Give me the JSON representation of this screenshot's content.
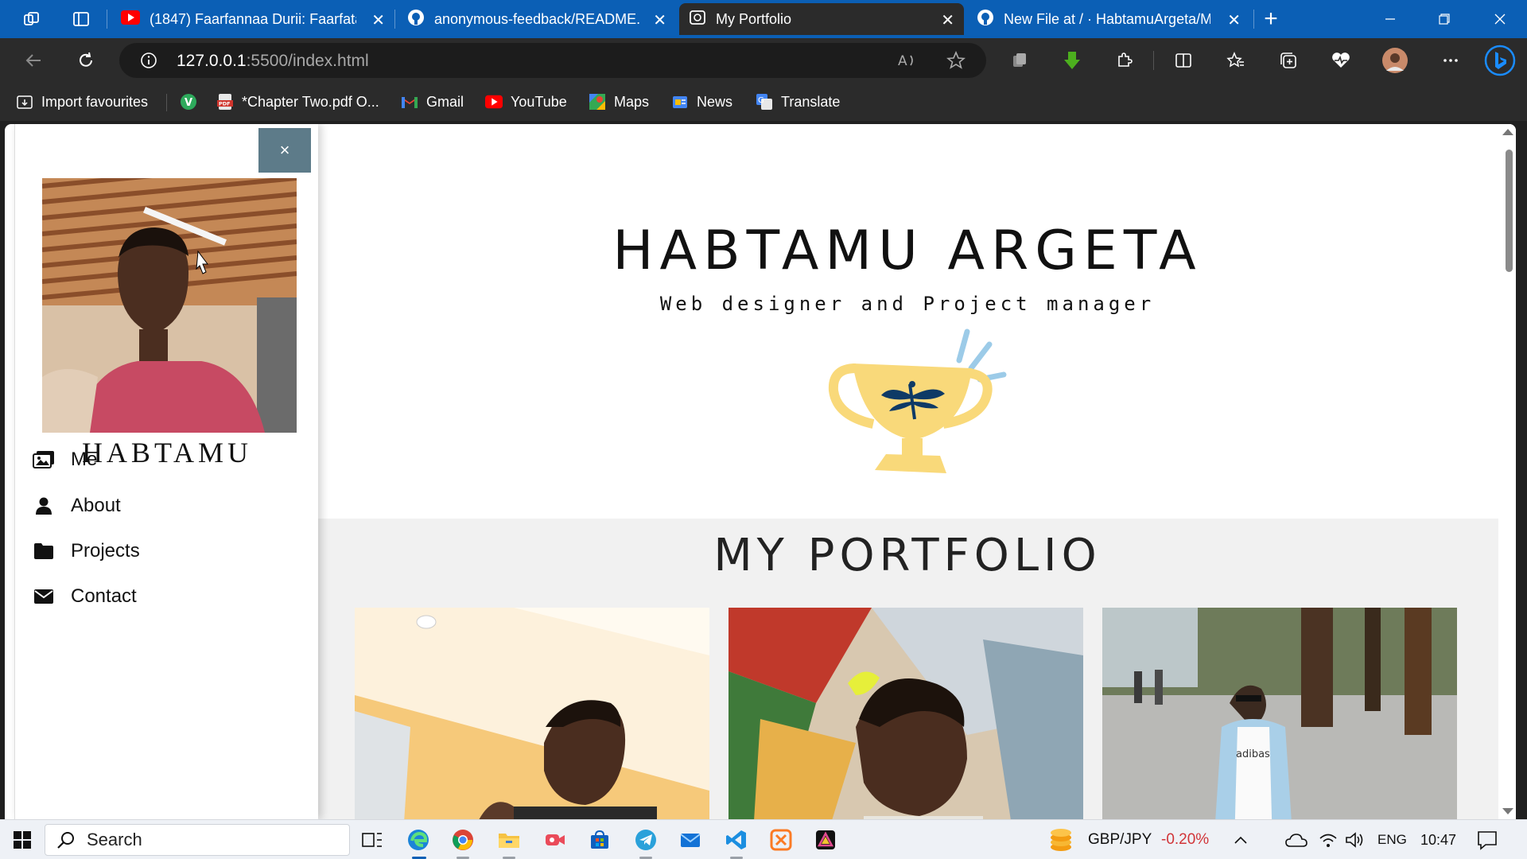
{
  "browser": {
    "tabs": [
      {
        "title": "(1847) Faarfannaa Durii: Faarfata"
      },
      {
        "title": "anonymous-feedback/README.m"
      },
      {
        "title": "My Portfolio"
      },
      {
        "title": "New File at / · HabtamuArgeta/M"
      }
    ],
    "close_glyph": "✕",
    "new_tab_glyph": "+",
    "url_host": "127.0.0.1",
    "url_path": ":5500/index.html",
    "favorites": [
      {
        "label": "Import favourites"
      },
      {
        "label": ""
      },
      {
        "label": "*Chapter Two.pdf O..."
      },
      {
        "label": "Gmail"
      },
      {
        "label": "YouTube"
      },
      {
        "label": "Maps"
      },
      {
        "label": "News"
      },
      {
        "label": "Translate"
      }
    ]
  },
  "page": {
    "sidenav": {
      "close_label": "×",
      "name": "HABTAMU",
      "items": [
        {
          "label": "Me",
          "icon": "images-icon"
        },
        {
          "label": "About",
          "icon": "user-icon"
        },
        {
          "label": "Projects",
          "icon": "folder-icon"
        },
        {
          "label": "Contact",
          "icon": "envelope-icon"
        }
      ]
    },
    "hero": {
      "title": "HABTAMU ARGETA",
      "subtitle": "Web designer and Project manager"
    },
    "portfolio": {
      "title": "MY PORTFOLIO"
    }
  },
  "taskbar": {
    "search_label": "Search",
    "ticker_pair": "GBP/JPY",
    "ticker_change": "-0.20%",
    "lang": "ENG",
    "time": "10:47"
  },
  "colors": {
    "tabstrip": "#0b5fb5",
    "toolbar": "#2b2b2b",
    "close_button": "#5d7b89",
    "trophy": "#f9d97a",
    "ticker_negative": "#d13438"
  }
}
